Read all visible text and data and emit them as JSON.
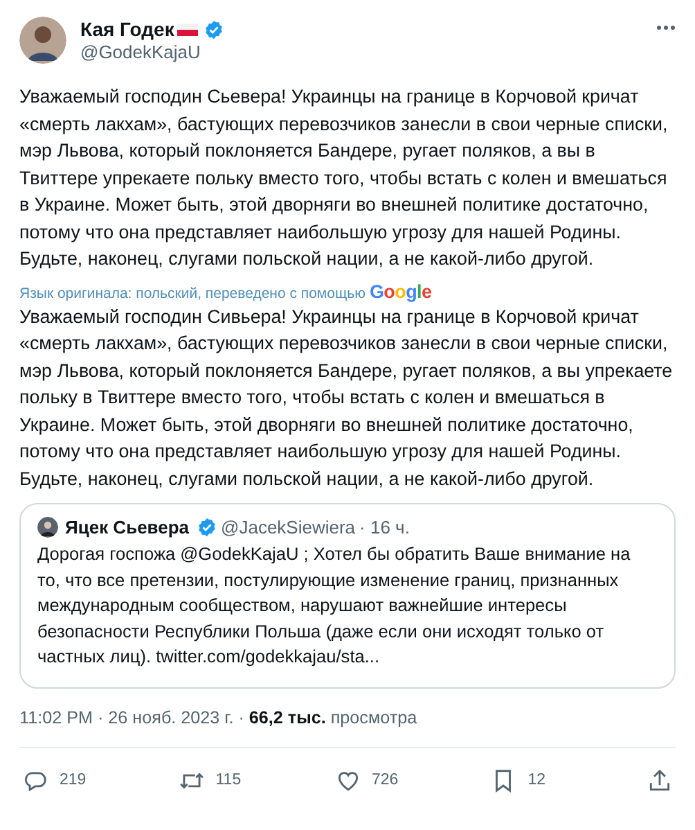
{
  "author": {
    "name": "Кая Годек",
    "handle": "@GodekKajaU",
    "verified": true
  },
  "original_text": "Уважаемый господин Сьевера! Украинцы на границе в Корчовой кричат «смерть лакхам», бастующих перевозчиков занесли в свои черные списки, мэр Львова, который поклоняется Бандере, ругает поляков, а вы в Твиттере упрекаете польку вместо того, чтобы встать с колен и вмешаться в Украине. Может быть, этой дворняги во внешней политике достаточно, потому что она представляет наибольшую угрозу для нашей Родины. Будьте, наконец, слугами польской нации, а не какой-либо другой.",
  "translation_note": "Язык оригинала: польский, переведено с помощью",
  "translation_brand": "Google",
  "translated_text": "Уважаемый господин Сивьера! Украинцы на границе в Корчовой кричат «смерть лакхам», бастующих перевозчиков занесли в свои черные списки, мэр Львова, который поклоняется Бандере, ругает поляков, а вы упрекаете польку в Твиттере вместо того, чтобы встать с колен и вмешаться в Украине. Может быть, этой дворняги во внешней политике достаточно, потому что она представляет наибольшую угрозу для нашей Родины. Будьте, наконец, слугами польской нации, а не какой-либо другой.",
  "quote": {
    "name": "Яцек Сьевера",
    "verified": true,
    "handle": "@JacekSiewiera",
    "time": "· 16 ч.",
    "text": "Дорогая госпожа @GodekKajaU ; Хотел бы обратить Ваше внимание на то, что все претензии, постулирующие изменение границ, признанных международным сообществом, нарушают важнейшие интересы безопасности Республики Польша (даже если они исходят только от частных лиц). twitter.com/godekkajau/sta..."
  },
  "meta": "11:02 PM · 26 нояб. 2023 г. · **66,2 тыс.** просмотра",
  "actions": [
    {
      "kind": "reply",
      "count": "219"
    },
    {
      "kind": "retweet",
      "count": "115"
    },
    {
      "kind": "like",
      "count": "726"
    },
    {
      "kind": "bookmark",
      "count": "12"
    },
    {
      "kind": "share"
    }
  ]
}
